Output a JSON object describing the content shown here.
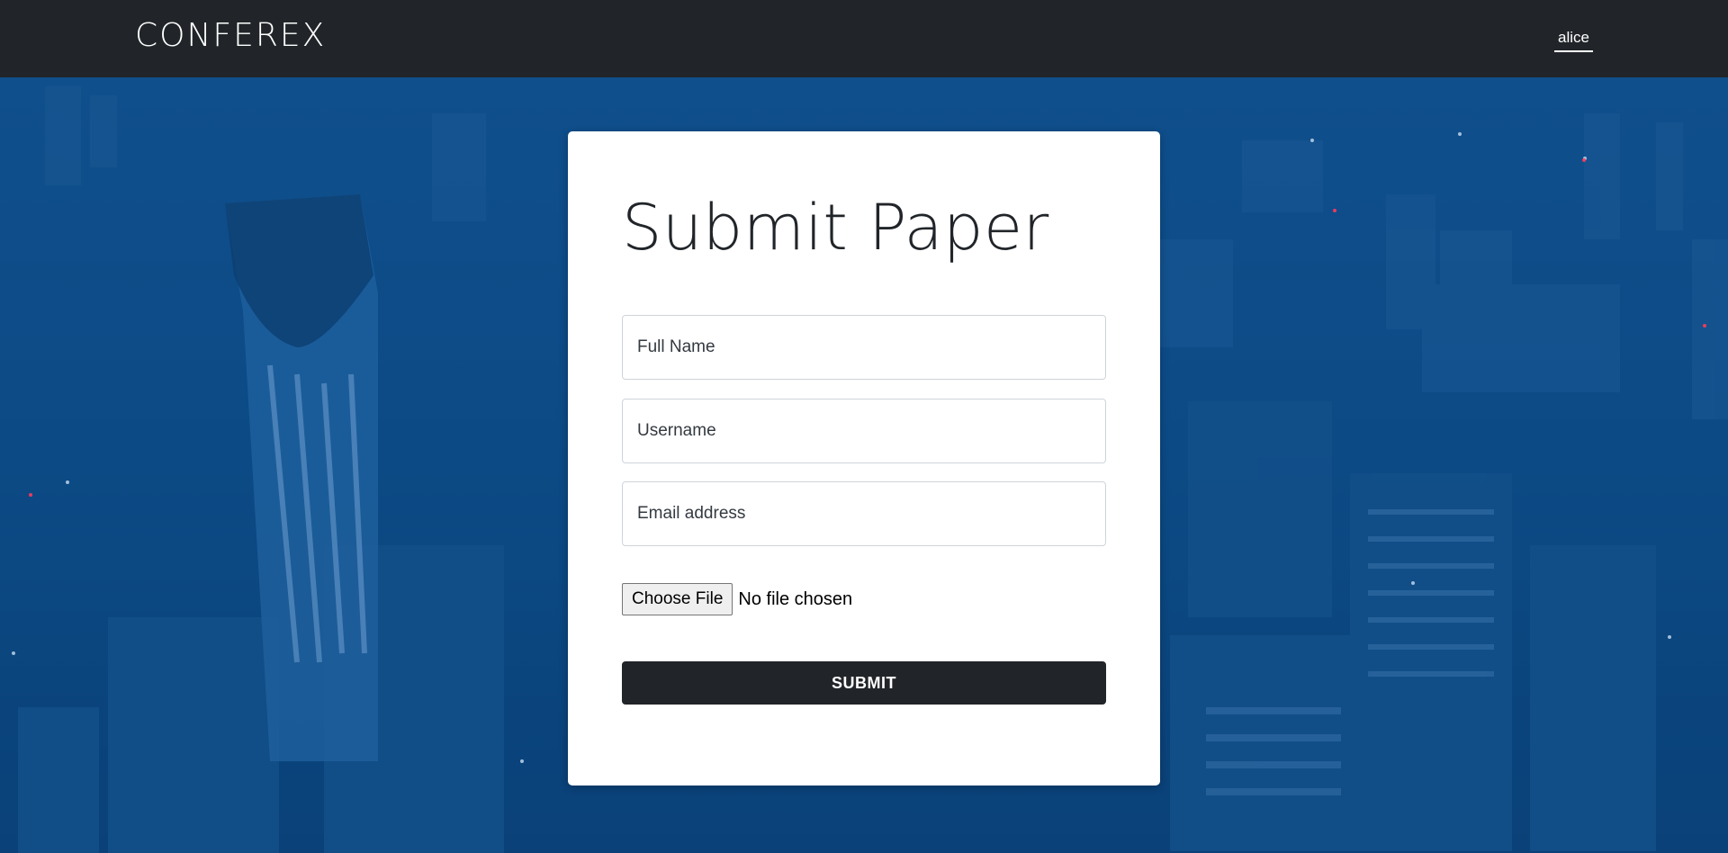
{
  "navbar": {
    "brand": "CONFEREX",
    "user": "alice"
  },
  "form": {
    "title": "Submit Paper",
    "full_name_placeholder": "Full Name",
    "username_placeholder": "Username",
    "email_placeholder": "Email address",
    "file_button_label": "Choose File",
    "file_status": "No file chosen",
    "submit_label": "SUBMIT"
  },
  "colors": {
    "navbar_bg": "#212529",
    "page_bg": "#0b4a86",
    "button_bg": "#212529"
  }
}
